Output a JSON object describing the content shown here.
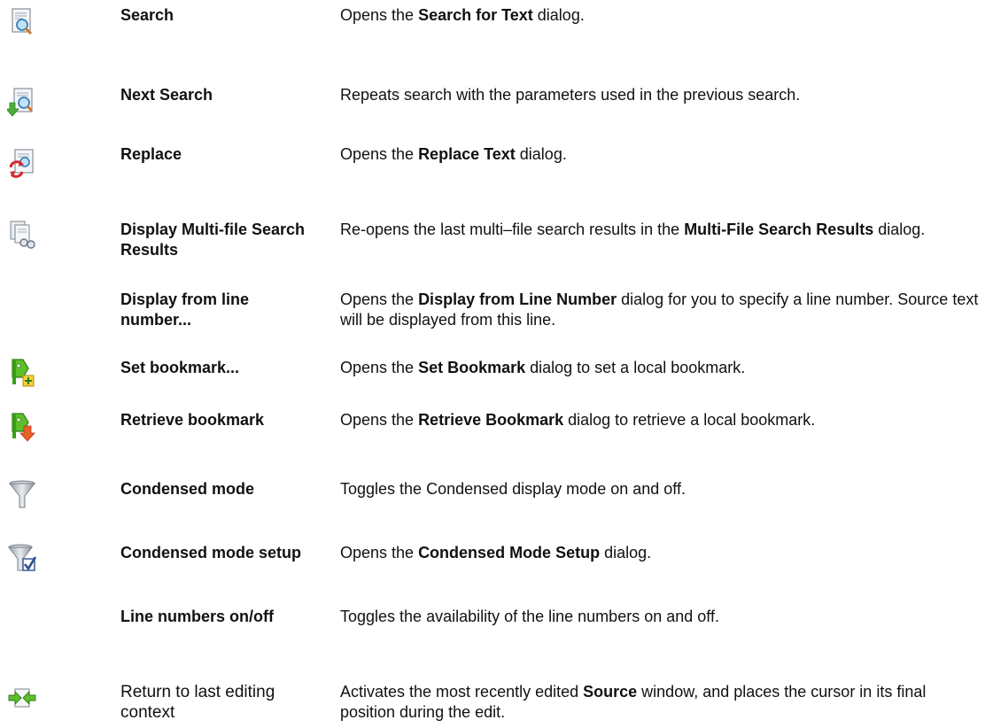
{
  "rows": [
    {
      "icon": "search-document-icon",
      "term": "Search",
      "desc": [
        {
          "t": "Opens the "
        },
        {
          "t": "Search for Text",
          "b": true
        },
        {
          "t": "  dialog."
        }
      ]
    },
    {
      "icon": "next-search-icon",
      "term": "Next Search",
      "desc": [
        {
          "t": "Repeats search with the parameters used in the previous search."
        }
      ]
    },
    {
      "icon": "replace-icon",
      "term": "Replace",
      "desc": [
        {
          "t": "Opens the "
        },
        {
          "t": "Replace Text",
          "b": true
        },
        {
          "t": " dialog."
        }
      ]
    },
    {
      "icon": "multi-file-search-results-icon",
      "term": "Display Multi-file Search Results",
      "desc": [
        {
          "t": "Re-opens the last multi–file search results in the "
        },
        {
          "t": "Multi-File Search Results",
          "b": true
        },
        {
          "t": " dialog."
        }
      ]
    },
    {
      "icon": "",
      "term": "Display from line number...",
      "desc": [
        {
          "t": "Opens the "
        },
        {
          "t": "Display from Line Number",
          "b": true
        },
        {
          "t": " dialog for you to specify a line number. Source text will be displayed from this line."
        }
      ]
    },
    {
      "icon": "set-bookmark-icon",
      "term": "Set bookmark...",
      "desc": [
        {
          "t": "Opens the "
        },
        {
          "t": "Set Bookmark",
          "b": true
        },
        {
          "t": " dialog  to set a local bookmark."
        }
      ]
    },
    {
      "icon": "retrieve-bookmark-icon",
      "term": "Retrieve bookmark",
      "desc": [
        {
          "t": "Opens the "
        },
        {
          "t": "Retrieve Bookmark",
          "b": true
        },
        {
          "t": " dialog to retrieve a local bookmark."
        }
      ]
    },
    {
      "icon": "funnel-icon",
      "term": "Condensed mode",
      "desc": [
        {
          "t": "Toggles the Condensed display mode on and off."
        }
      ]
    },
    {
      "icon": "funnel-check-icon",
      "term": "Condensed mode setup",
      "desc": [
        {
          "t": "Opens the "
        },
        {
          "t": "Condensed Mode Setup",
          "b": true
        },
        {
          "t": " dialog."
        }
      ]
    },
    {
      "icon": "",
      "term": "Line numbers on/off",
      "desc": [
        {
          "t": "Toggles the availability of the line numbers on and off."
        }
      ]
    },
    {
      "icon": "return-to-context-icon",
      "term": "Return to last editing context",
      "term_plain": true,
      "desc": [
        {
          "t": " Activates the most recently edited "
        },
        {
          "t": "Source",
          "b": true
        },
        {
          "t": " window, and places the cursor in its final position during the edit."
        }
      ]
    }
  ]
}
